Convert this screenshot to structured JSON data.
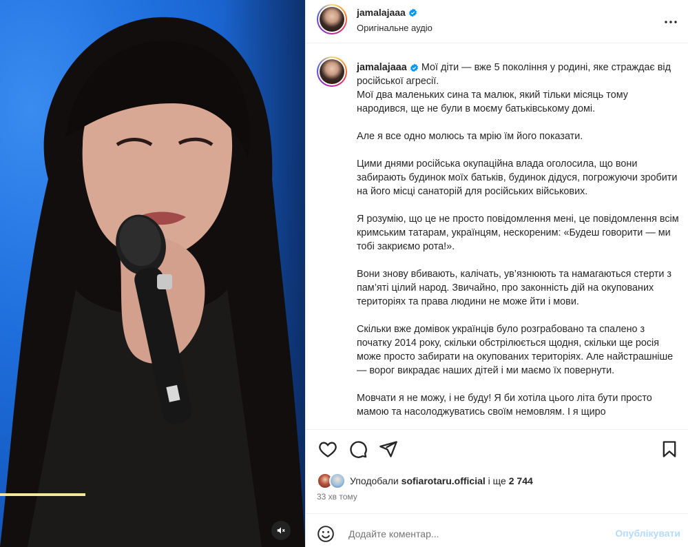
{
  "media": {
    "mute_icon": "speaker-muted-icon",
    "progress_fraction": 0.28
  },
  "header": {
    "username": "jamalajaaa",
    "subtitle": "Оригінальне аудіо",
    "more_icon": "more-horizontal-icon"
  },
  "caption": {
    "username": "jamalajaaa",
    "paragraphs": [
      "Мої діти — вже 5 покоління у родині, яке страждає від російської агресії.\nМої два маленьких сина та малюк, який тільки місяць тому народився, ще не були в моєму батьківському домі.",
      "Але я все одно молюсь та мрію їм його показати.",
      "Цими днями російська окупаційна влада оголосила, що вони забирають будинок моїх батьків, будинок дідуся, погрожуючи зробити на його місці санаторій для російських військових.",
      "Я розумію, що це не просто повідомлення мені, це повідомлення всім кримським татарам, українцям, нескореним: «Будеш говорити — ми тобі закриємо рота!».",
      "Вони знову вбивають, калічать, ув’язнюють та намагаються стерти з пам’яті цілий народ. Звичайно, про законність дій на окупованих територіях та права людини не може йти і мови.",
      "Скільки вже домівок українців було розграбовано та спалено з початку 2014 року, скільки обстрілюється щодня, скільки ще росія може просто забирати на окупованих територіях. Але найстрашніше — ворог викрадає наших дітей і ми маємо їх повернути.",
      "Мовчати я не можу, і не буду! Я би хотіла цього літа бути просто мамою та насолоджуватись своїм немовлям. І я щиро"
    ]
  },
  "actions": {
    "like_icon": "heart-icon",
    "comment_icon": "comment-icon",
    "share_icon": "share-icon",
    "save_icon": "bookmark-icon"
  },
  "likes": {
    "prefix": "Уподобали",
    "user": "sofiarotaru.official",
    "suffix": " і ще ",
    "count": "2 744"
  },
  "timestamp": "33 хв тому",
  "comment": {
    "placeholder": "Додайте коментар...",
    "post_label": "Опублікувати",
    "emoji_icon": "emoji-icon"
  },
  "colors": {
    "verified": "#0095f6",
    "post_disabled": "#b3dbff",
    "progress": "#f3e7a0"
  }
}
